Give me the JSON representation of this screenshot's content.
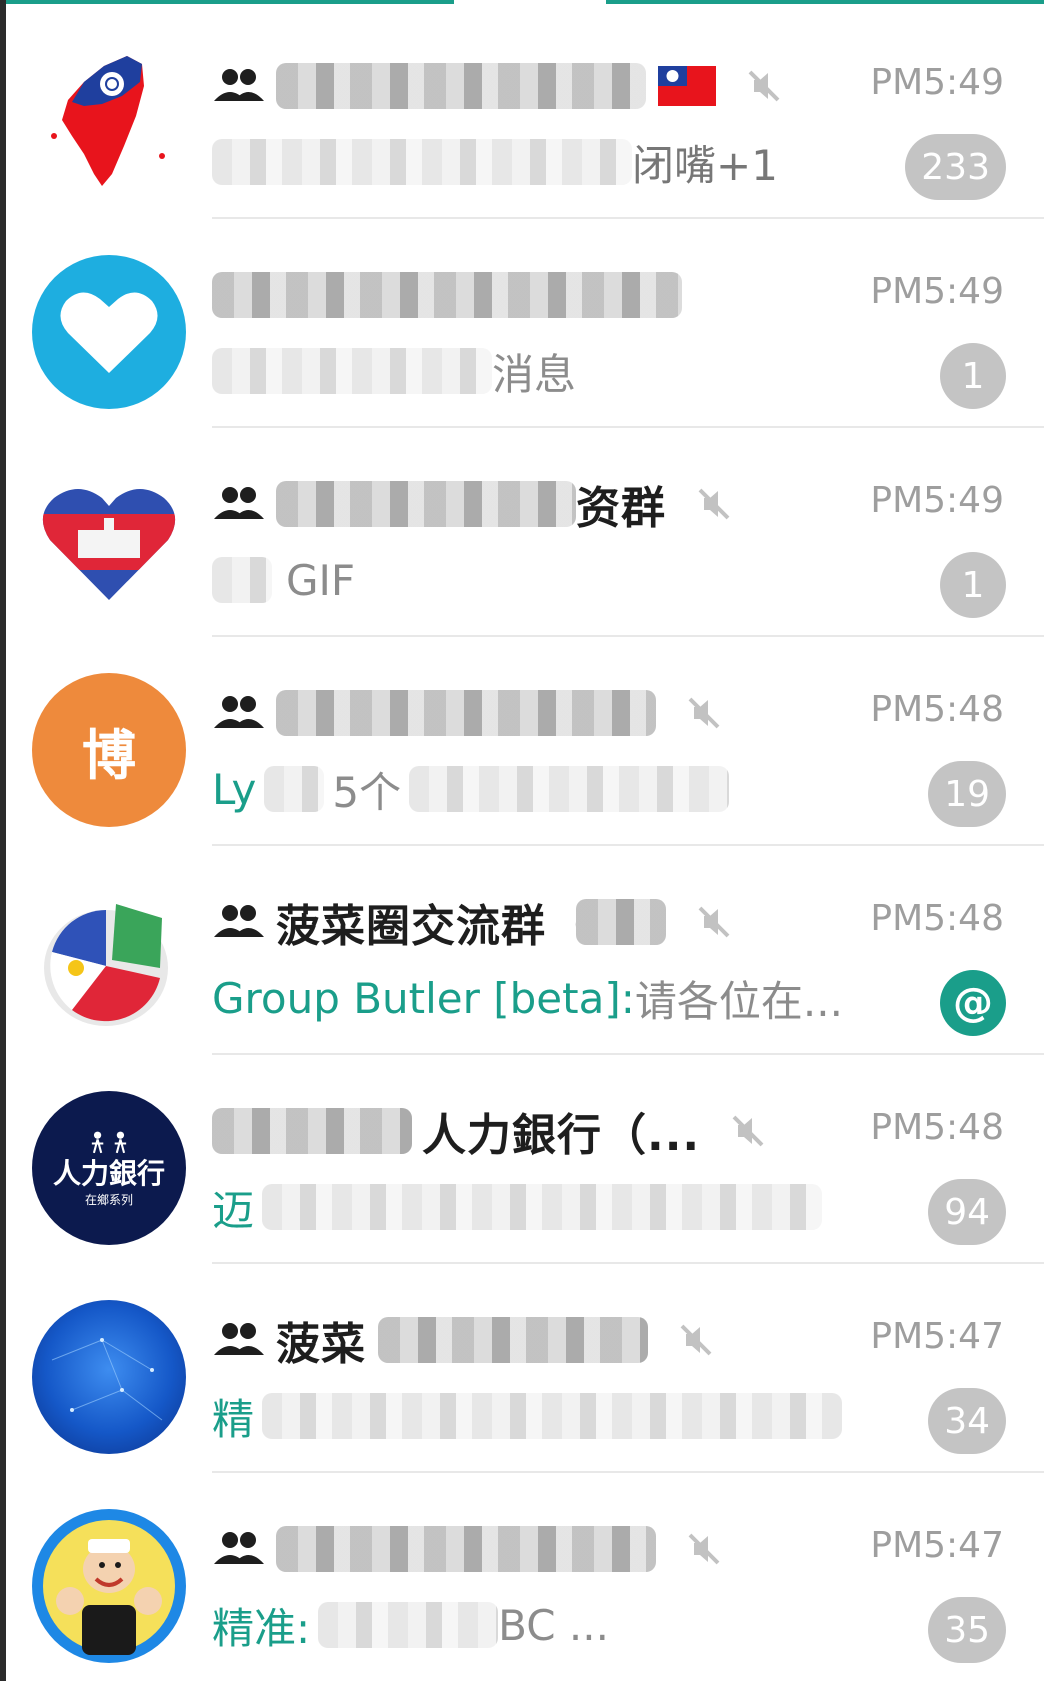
{
  "colors": {
    "accent": "#1a9e8a",
    "badge_muted": "#c4c4c4",
    "time": "#9e9e9e"
  },
  "chats": [
    {
      "avatar": "taiwan-map-avatar",
      "group": true,
      "title": "",
      "flag": "taiwan-flag-icon",
      "muted": true,
      "time": "PM5:49",
      "sender": "",
      "message": "闭嘴+1",
      "badge": "233"
    },
    {
      "avatar": "blue-heart-avatar",
      "group": false,
      "title": "",
      "muted": false,
      "time": "PM5:49",
      "sender": "",
      "message": "消息",
      "badge": "1"
    },
    {
      "avatar": "cambodia-heart-avatar",
      "group": true,
      "title": "资群",
      "muted": true,
      "time": "PM5:49",
      "sender": "",
      "message": "GIF",
      "badge": "1"
    },
    {
      "avatar": "orange-bo-avatar",
      "group": true,
      "title": "",
      "muted": true,
      "time": "PM5:48",
      "sender": "Ly",
      "message": "5个",
      "badge": "19"
    },
    {
      "avatar": "philippines-pie-avatar",
      "group": true,
      "title": "菠菜圈交流群（",
      "muted": true,
      "time": "PM5:48",
      "sender": "Group Butler [beta]:",
      "message": " 请各位在...",
      "badge": "@",
      "mention": true
    },
    {
      "avatar": "human-bank-avatar",
      "group": true,
      "title": "人力銀行（...",
      "muted": true,
      "time": "PM5:48",
      "sender": "迈",
      "message": "",
      "badge": "94"
    },
    {
      "avatar": "blue-network-avatar",
      "group": true,
      "title": "菠菜",
      "muted": true,
      "time": "PM5:47",
      "sender": "精",
      "message": "",
      "badge": "34"
    },
    {
      "avatar": "popeye-avatar",
      "group": true,
      "title": "",
      "muted": true,
      "time": "PM5:47",
      "sender": "精准:",
      "message": " BC ...",
      "badge": "35"
    }
  ],
  "avatar_texts": {
    "orange": "博",
    "bank_line1": "人力銀行",
    "bank_line2": "在鄉系列"
  }
}
